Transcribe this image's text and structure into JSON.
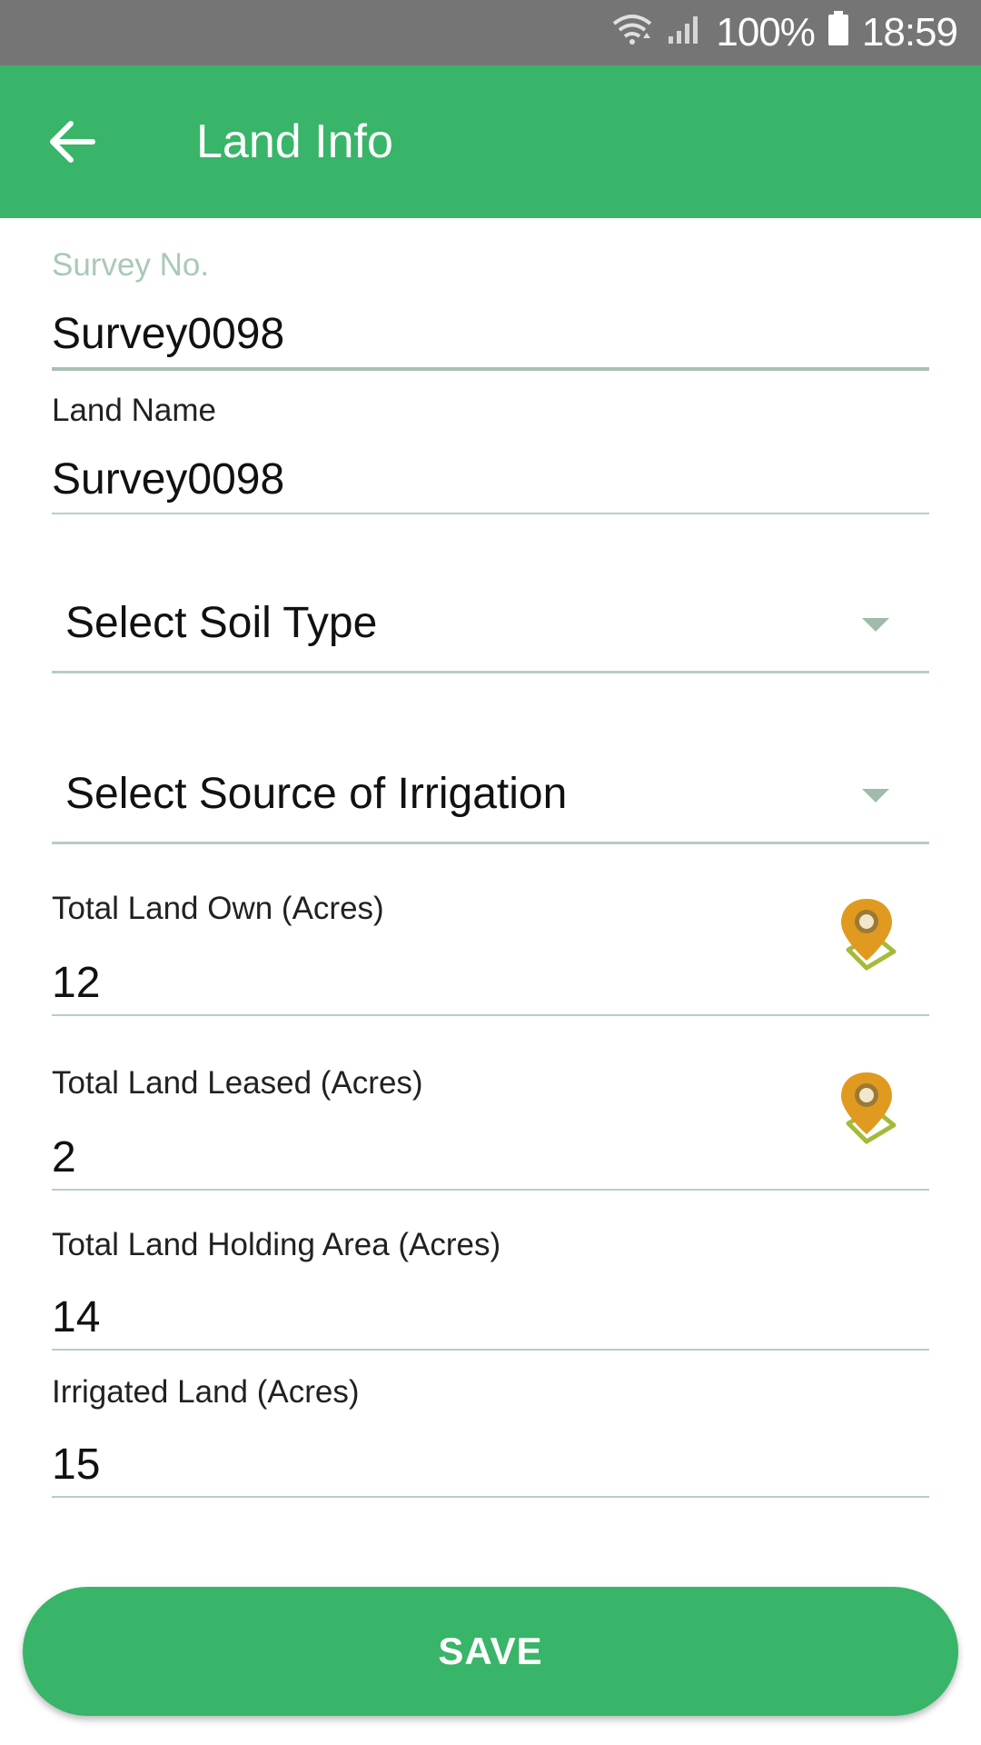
{
  "status_bar": {
    "wifi_icon": "wifi-icon",
    "signal_icon": "signal-icon",
    "battery_text": "100%",
    "battery_icon": "battery-icon",
    "time": "18:59"
  },
  "app_bar": {
    "back_icon": "arrow-back-icon",
    "title": "Land Info",
    "color": "#38b568"
  },
  "form": {
    "survey_no": {
      "label": "Survey No.",
      "value": "Survey0098"
    },
    "land_name": {
      "label": "Land Name",
      "value": "Survey0098"
    },
    "soil_type": {
      "selected": "Select Soil Type"
    },
    "irrigation_source": {
      "selected": "Select Source of Irrigation"
    },
    "total_land_own": {
      "label": "Total Land Own (Acres)",
      "value": "12",
      "icon": "map-pin-icon"
    },
    "total_land_leased": {
      "label": "Total Land Leased (Acres)",
      "value": "2",
      "icon": "map-pin-icon"
    },
    "total_land_holding": {
      "label": "Total Land Holding Area (Acres)",
      "value": "14"
    },
    "irrigated_land": {
      "label": "Irrigated Land (Acres)",
      "value": "15"
    }
  },
  "save_button": {
    "label": "SAVE"
  }
}
